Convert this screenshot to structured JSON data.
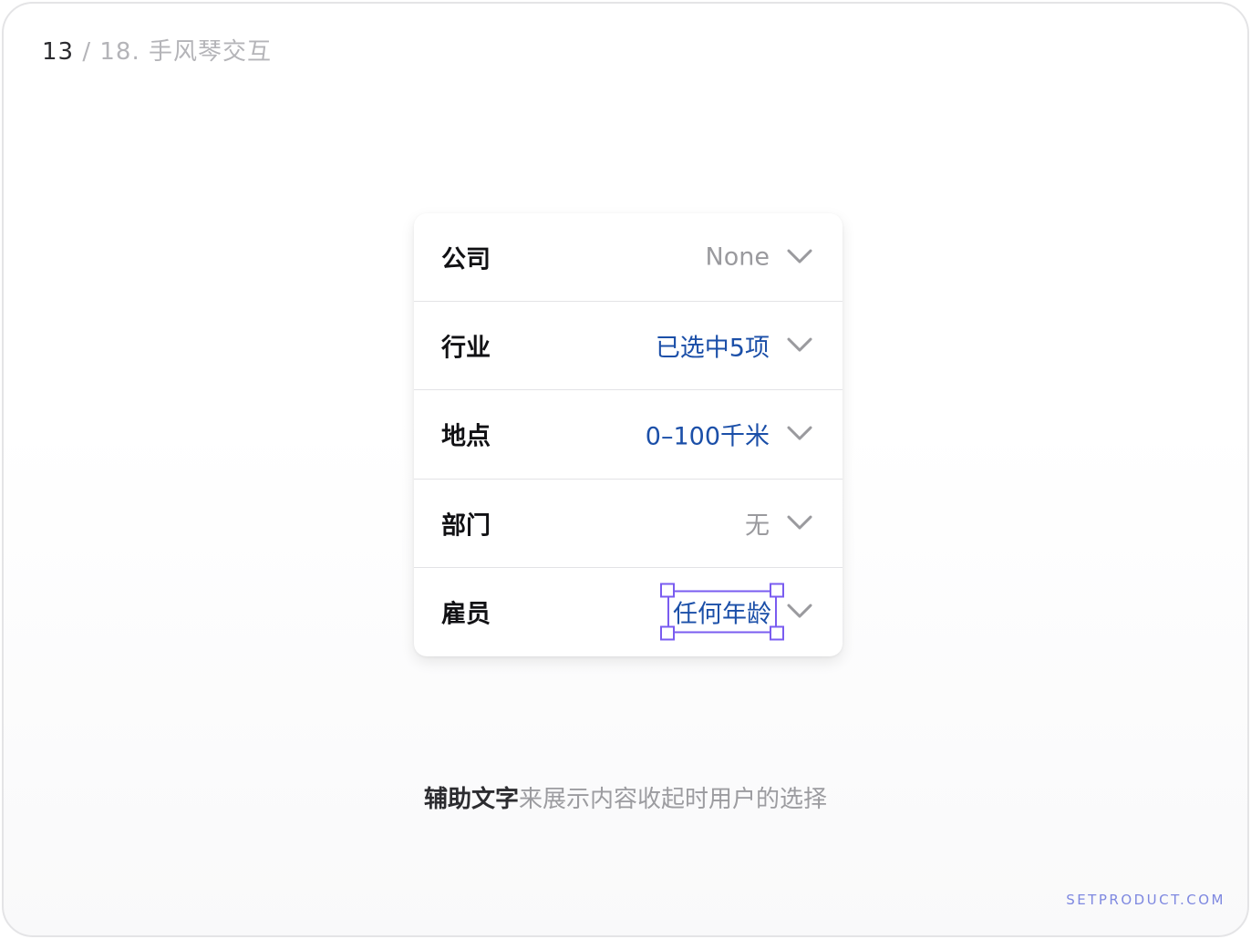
{
  "header": {
    "current_page": "13",
    "total_pages": " / 18.",
    "section_title": "手风琴交互"
  },
  "rows": [
    {
      "label": "公司",
      "value": "None",
      "state": "muted",
      "icon": "chevron-down-icon"
    },
    {
      "label": "行业",
      "value": "已选中5项",
      "state": "active",
      "icon": "chevron-down-icon"
    },
    {
      "label": "地点",
      "value": "0–100千米",
      "state": "active",
      "icon": "chevron-down-icon"
    },
    {
      "label": "部门",
      "value": "无",
      "state": "muted",
      "icon": "chevron-down-icon"
    },
    {
      "label": "雇员",
      "value": "任何年龄",
      "state": "active",
      "icon": "chevron-down-icon",
      "selected": true
    }
  ],
  "caption": {
    "strong": "辅助文字",
    "light": "来展示内容收起时用户的选择"
  },
  "brand": "SETPRODUCT.COM",
  "colors": {
    "active_value": "#1b4fa8",
    "muted_value": "#9a9a9e",
    "selection": "#7a5cf0",
    "brand": "#7e88e0"
  }
}
